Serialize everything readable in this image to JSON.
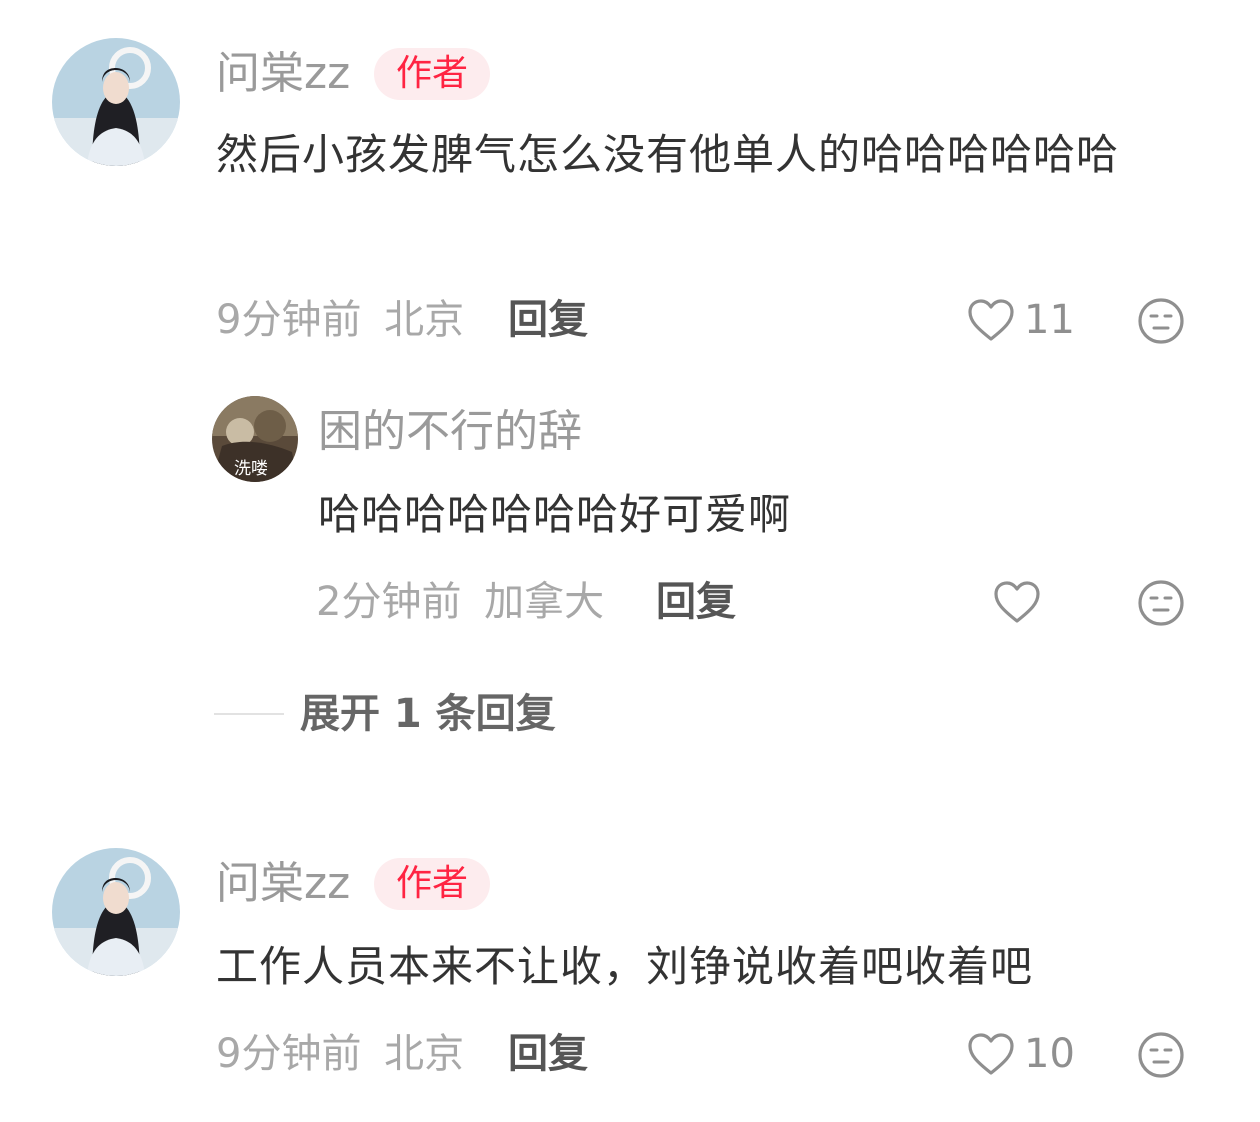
{
  "comments": [
    {
      "username": "问棠zz",
      "badge": "作者",
      "content": "然后小孩发脾气怎么没有他单人的哈哈哈哈哈哈",
      "time": "9分钟前",
      "location": "北京",
      "reply_label": "回复",
      "likes": "11",
      "replies": [
        {
          "username": "困的不行的辞",
          "avatar_text": "洗喽",
          "content": "哈哈哈哈哈哈哈好可爱啊",
          "time": "2分钟前",
          "location": "加拿大",
          "reply_label": "回复",
          "likes": ""
        }
      ],
      "expand_label": "展开 1 条回复"
    },
    {
      "username": "问棠zz",
      "badge": "作者",
      "content": "工作人员本来不让收，刘铮说收着吧收着吧",
      "time": "9分钟前",
      "location": "北京",
      "reply_label": "回复",
      "likes": "10"
    }
  ],
  "icons": {
    "like": "heart-outline-icon",
    "emotion": "neutral-face-icon"
  },
  "colors": {
    "badge_text": "#ff2442",
    "badge_bg": "#fdecee",
    "username": "#9a9a9a",
    "content": "#333333",
    "meta": "#a8a8a8"
  }
}
